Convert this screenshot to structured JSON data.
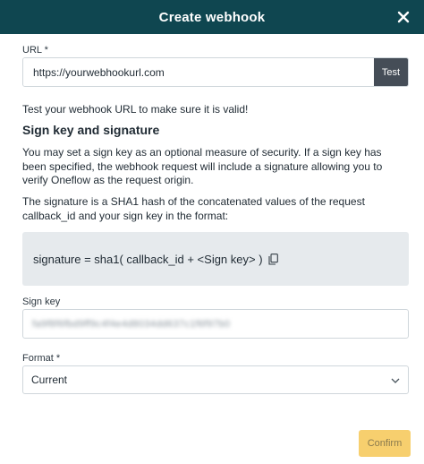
{
  "header": {
    "title": "Create webhook",
    "close_icon": "close-icon"
  },
  "url": {
    "label": "URL *",
    "value": "https://yourwebhookurl.com",
    "test_label": "Test"
  },
  "hint": "Test your webhook URL to make sure it is valid!",
  "sign_section": {
    "title": "Sign key and signature",
    "paragraph1": "You may set a sign key as an optional measure of security. If a sign key has been specified, the webhook request will include a signature allowing you to verify Oneflow as the request origin.",
    "paragraph2": "The signature is a SHA1 hash of the concatenated values of the request callback_id and your sign key in the format:",
    "signature_formula": "signature = sha1( callback_id + <Sign key> )",
    "copy_icon": "copy-icon"
  },
  "sign_key": {
    "label": "Sign key",
    "value": "fa9f8f6fbd9ff9c4f4e4d8034dd637c1f6f97b0"
  },
  "format": {
    "label": "Format *",
    "selected": "Current",
    "chevron_icon": "chevron-down-icon"
  },
  "footer": {
    "confirm_label": "Confirm"
  },
  "colors": {
    "header_bg": "#0f4650",
    "test_button_bg": "#454d57",
    "confirm_button_bg": "#f7cf6e",
    "signature_box_bg": "#e6eaed"
  }
}
